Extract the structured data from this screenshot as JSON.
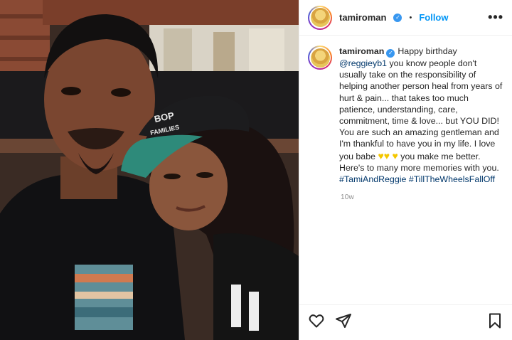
{
  "post": {
    "username": "tamiroman",
    "verified": true,
    "header_separator": "•",
    "follow_label": "Follow",
    "more_label": "•••",
    "caption": {
      "username": "tamiroman",
      "part1": "Happy birthday ",
      "mention": "@reggieyb1",
      "part2": " you know people don't usually take on the responsibility of helping another person heal from years of hurt & pain... that takes too much patience, understanding, care, commitment, time & love... but YOU DID! You are such an amazing gentleman and I'm thankful to have you in my life. I love you babe ",
      "heart_glyph": "♥",
      "part3": " you make me better. Here's to many more memories with you. ",
      "hashtag1": "#TamiAndReggie",
      "hashtag2": "#TillTheWheelsFallOff"
    },
    "timestamp": "10w"
  },
  "photo": {
    "cap_text_1": "BOP",
    "cap_text_2": "FAMILIES"
  },
  "colors": {
    "accent": "#0095f6",
    "link": "#00376b",
    "verified": "#3897f0",
    "heart": "#f4c700"
  },
  "icons": [
    "heart-icon",
    "send-icon",
    "bookmark-icon",
    "more-icon",
    "verified-icon"
  ]
}
